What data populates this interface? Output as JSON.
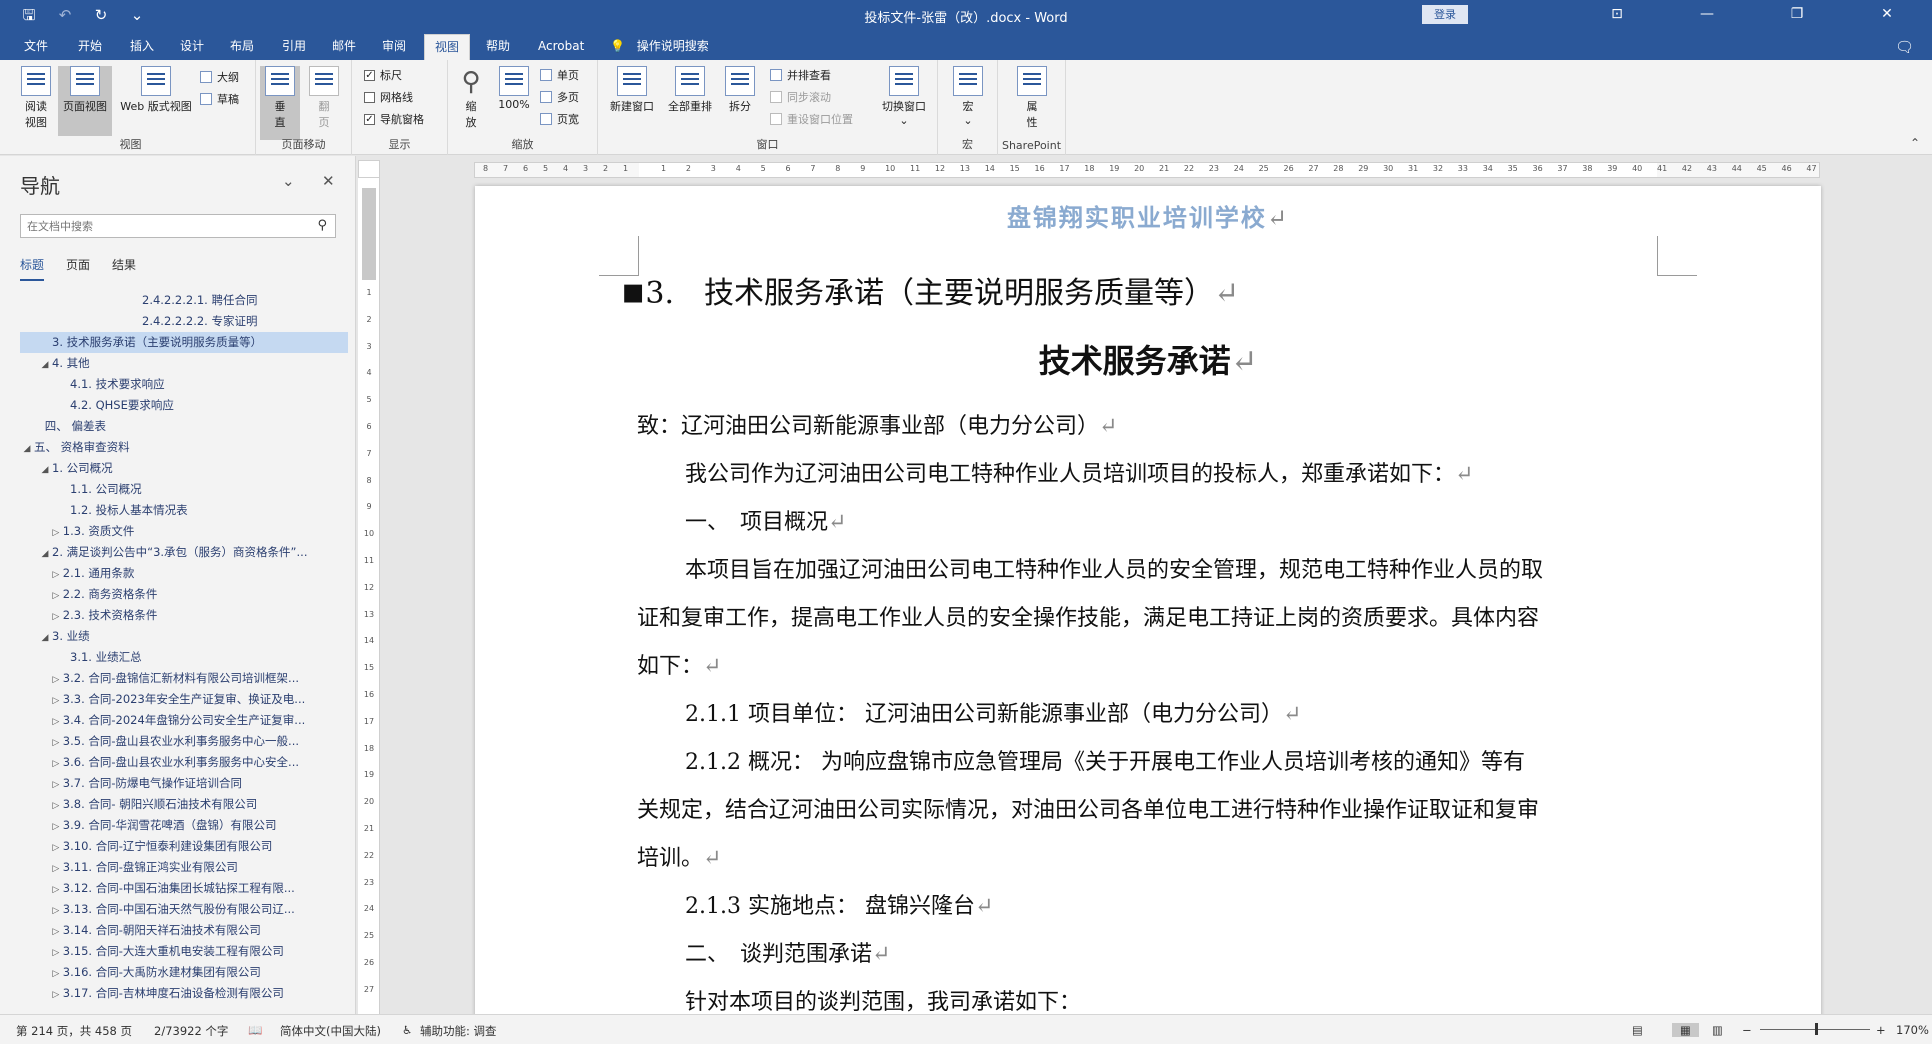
{
  "titlebar": {
    "title": "投标文件-张雷（改）.docx  -  Word",
    "login": "登录",
    "qat": {
      "save": "🖫",
      "undo": "↶",
      "redo": "↻",
      "customize": "⌄"
    },
    "win": {
      "ribbon_opts": "⊡",
      "minimize": "—",
      "restore": "❐",
      "close": "✕"
    }
  },
  "tabs": [
    {
      "label": "文件"
    },
    {
      "label": "开始"
    },
    {
      "label": "插入"
    },
    {
      "label": "设计"
    },
    {
      "label": "布局"
    },
    {
      "label": "引用"
    },
    {
      "label": "邮件"
    },
    {
      "label": "审阅"
    },
    {
      "label": "视图"
    },
    {
      "label": "帮助"
    },
    {
      "label": "Acrobat"
    }
  ],
  "tellme": "操作说明搜索",
  "tellme_icon": "💡",
  "comment_icon": "🗨",
  "ribbon": {
    "views": {
      "read": "阅读视图",
      "print": "页面视图",
      "web": "Web 版式视图",
      "outline": "大纲",
      "draft": "草稿",
      "label": "视图"
    },
    "move": {
      "vertical": "垂直",
      "side": "翻页",
      "label": "页面移动"
    },
    "show": {
      "ruler": "标尺",
      "grid": "网格线",
      "navpane": "导航窗格",
      "label": "显示"
    },
    "zoom": {
      "zoom": "缩放",
      "hundred": "100%",
      "one": "单页",
      "multi": "多页",
      "width": "页宽",
      "label": "缩放"
    },
    "window": {
      "new": "新建窗口",
      "arrange": "全部重排",
      "split": "拆分",
      "side_by_side": "并排查看",
      "sync": "同步滚动",
      "reset": "重设窗口位置",
      "switch": "切换窗口",
      "label": "窗口"
    },
    "macro": {
      "macro": "宏",
      "label": "宏"
    },
    "sharepoint": {
      "props": "属性",
      "label": "SharePoint"
    },
    "collapse": "⌃"
  },
  "nav": {
    "title": "导航",
    "search_placeholder": "在文档中搜索",
    "search_icon": "⚲",
    "tabs": [
      "标题",
      "页面",
      "结果"
    ],
    "items": [
      {
        "text": "2.4.2.2.2.1. 聘任合同",
        "indent": 6,
        "tri": ""
      },
      {
        "text": "2.4.2.2.2.2. 专家证明",
        "indent": 6,
        "tri": ""
      },
      {
        "text": "3. 技术服务承诺（主要说明服务质量等）",
        "indent": 1,
        "tri": "",
        "sel": true
      },
      {
        "text": "4. 其他",
        "indent": 1,
        "tri": "◢"
      },
      {
        "text": "4.1. 技术要求响应",
        "indent": 2,
        "tri": ""
      },
      {
        "text": "4.2. QHSE要求响应",
        "indent": 2,
        "tri": ""
      },
      {
        "text": "四、 偏差表",
        "indent": 0.6,
        "tri": ""
      },
      {
        "text": "五、 资格审查资料",
        "indent": 0,
        "tri": "◢"
      },
      {
        "text": "1. 公司概况",
        "indent": 1,
        "tri": "◢"
      },
      {
        "text": "1.1. 公司概况",
        "indent": 2,
        "tri": ""
      },
      {
        "text": "1.2. 投标人基本情况表",
        "indent": 2,
        "tri": ""
      },
      {
        "text": "1.3. 资质文件",
        "indent": 1.6,
        "tri": "▷"
      },
      {
        "text": "2. 满足谈判公告中“3.承包（服务）商资格条件”...",
        "indent": 1,
        "tri": "◢"
      },
      {
        "text": "2.1. 通用条款",
        "indent": 1.6,
        "tri": "▷"
      },
      {
        "text": "2.2. 商务资格条件",
        "indent": 1.6,
        "tri": "▷"
      },
      {
        "text": "2.3. 技术资格条件",
        "indent": 1.6,
        "tri": "▷"
      },
      {
        "text": "3. 业绩",
        "indent": 1,
        "tri": "◢"
      },
      {
        "text": "3.1. 业绩汇总",
        "indent": 2,
        "tri": ""
      },
      {
        "text": "3.2. 合同-盘锦信汇新材料有限公司培训框架...",
        "indent": 1.6,
        "tri": "▷"
      },
      {
        "text": "3.3. 合同-2023年安全生产证复审、换证及电...",
        "indent": 1.6,
        "tri": "▷"
      },
      {
        "text": "3.4. 合同-2024年盘锦分公司安全生产证复审...",
        "indent": 1.6,
        "tri": "▷"
      },
      {
        "text": "3.5. 合同-盘山县农业水利事务服务中心一般...",
        "indent": 1.6,
        "tri": "▷"
      },
      {
        "text": "3.6. 合同-盘山县农业水利事务服务中心安全...",
        "indent": 1.6,
        "tri": "▷"
      },
      {
        "text": "3.7. 合同-防爆电气操作证培训合同",
        "indent": 1.6,
        "tri": "▷"
      },
      {
        "text": "3.8. 合同- 朝阳兴顺石油技术有限公司",
        "indent": 1.6,
        "tri": "▷"
      },
      {
        "text": "3.9. 合同-华润雪花啤酒（盘锦）有限公司",
        "indent": 1.6,
        "tri": "▷"
      },
      {
        "text": "3.10. 合同-辽宁恒泰利建设集团有限公司",
        "indent": 1.6,
        "tri": "▷"
      },
      {
        "text": "3.11. 合同-盘锦正鸿实业有限公司",
        "indent": 1.6,
        "tri": "▷"
      },
      {
        "text": "3.12. 合同-中国石油集团长城钻探工程有限...",
        "indent": 1.6,
        "tri": "▷"
      },
      {
        "text": "3.13. 合同-中国石油天然气股份有限公司辽...",
        "indent": 1.6,
        "tri": "▷"
      },
      {
        "text": "3.14. 合同-朝阳天祥石油技术有限公司",
        "indent": 1.6,
        "tri": "▷"
      },
      {
        "text": "3.15. 合同-大连大重机电安装工程有限公司",
        "indent": 1.6,
        "tri": "▷"
      },
      {
        "text": "3.16. 合同-大禹防水建材集团有限公司",
        "indent": 1.6,
        "tri": "▷"
      },
      {
        "text": "3.17. 合同-吉林坤度石油设备检测有限公司",
        "indent": 1.6,
        "tri": "▷"
      }
    ]
  },
  "doc": {
    "header_school": "盘锦翔实职业培训学校",
    "heading3": "3.　技术服务承诺（主要说明服务质量等）",
    "title": "技术服务承诺",
    "to": "致：辽河油田公司新能源事业部（电力分公司）",
    "intro": "我公司作为辽河油田公司电工特种作业人员培训项目的投标人，郑重承诺如下：",
    "sec1": "一、　项目概况",
    "p1a": "本项目旨在加强辽河油田公司电工特种作业人员的安全管理，规范电工特种作业人员的取",
    "p1b": "证和复审工作，提高电工作业人员的安全操作技能，满足电工持证上岗的资质要求。具体内容",
    "p1c": "如下：",
    "s211": "2.1.1  项目单位：  辽河油田公司新能源事业部（电力分公司）",
    "s212a": "2.1.2  概况：  为响应盘锦市应急管理局《关于开展电工作业人员培训考核的通知》等有",
    "s212b": "关规定，结合辽河油田公司实际情况，对油田公司各单位电工进行特种作业操作证取证和复审",
    "s212c": "培训。",
    "s213": "2.1.3  实施地点：  盘锦兴隆台",
    "sec2": "二、　谈判范围承诺",
    "cut": "针对本项目的谈判范围，我司承诺如下：",
    "para_mark": "↵"
  },
  "status": {
    "page": "第 214 页，共 458 页",
    "words": "2/73922 个字",
    "proof_icon": "📖",
    "lang": "简体中文(中国大陆)",
    "access_icon": "♿",
    "access": "辅助功能: 调查",
    "zoom": "170%",
    "minus": "−",
    "plus": "+"
  }
}
